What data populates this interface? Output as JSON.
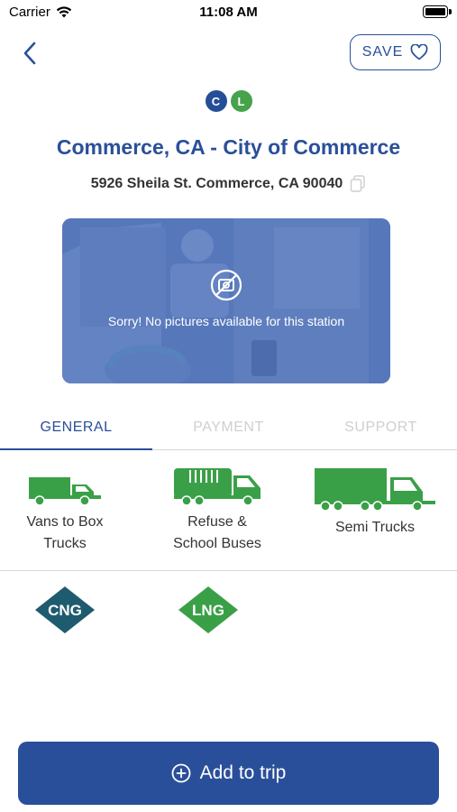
{
  "status_bar": {
    "carrier": "Carrier",
    "time": "11:08 AM",
    "wifi_icon": "wifi-icon",
    "battery_icon": "battery-icon"
  },
  "header": {
    "back_icon": "chevron-left-icon",
    "save_label": "SAVE",
    "save_icon": "heart-icon"
  },
  "fuel_badges": [
    {
      "letter": "C",
      "color": "#244e98"
    },
    {
      "letter": "L",
      "color": "#47a24c"
    }
  ],
  "station": {
    "title": "Commerce, CA - City of Commerce",
    "address": "5926 Sheila St. Commerce, CA 90040",
    "copy_icon": "copy-icon"
  },
  "photo": {
    "message": "Sorry! No pictures available for this station",
    "icon": "no-photo-icon"
  },
  "tabs": [
    {
      "label": "GENERAL",
      "active": true
    },
    {
      "label": "PAYMENT",
      "active": false
    },
    {
      "label": "SUPPORT",
      "active": false
    }
  ],
  "vehicles": [
    {
      "label_line1": "Vans to Box",
      "label_line2": "Trucks",
      "icon": "box-truck-icon"
    },
    {
      "label_line1": "Refuse &",
      "label_line2": "School Buses",
      "icon": "refuse-truck-icon"
    },
    {
      "label_line1": "Semi Trucks",
      "label_line2": "",
      "icon": "semi-truck-icon"
    }
  ],
  "fuel_types": [
    {
      "label": "CNG",
      "color": "#1f5b6e"
    },
    {
      "label": "LNG",
      "color": "#3aa047"
    }
  ],
  "add_trip": {
    "label": "Add to trip",
    "icon": "plus-circle-icon"
  },
  "colors": {
    "brand_blue": "#2a4f9a",
    "truck_green": "#3aa047"
  }
}
